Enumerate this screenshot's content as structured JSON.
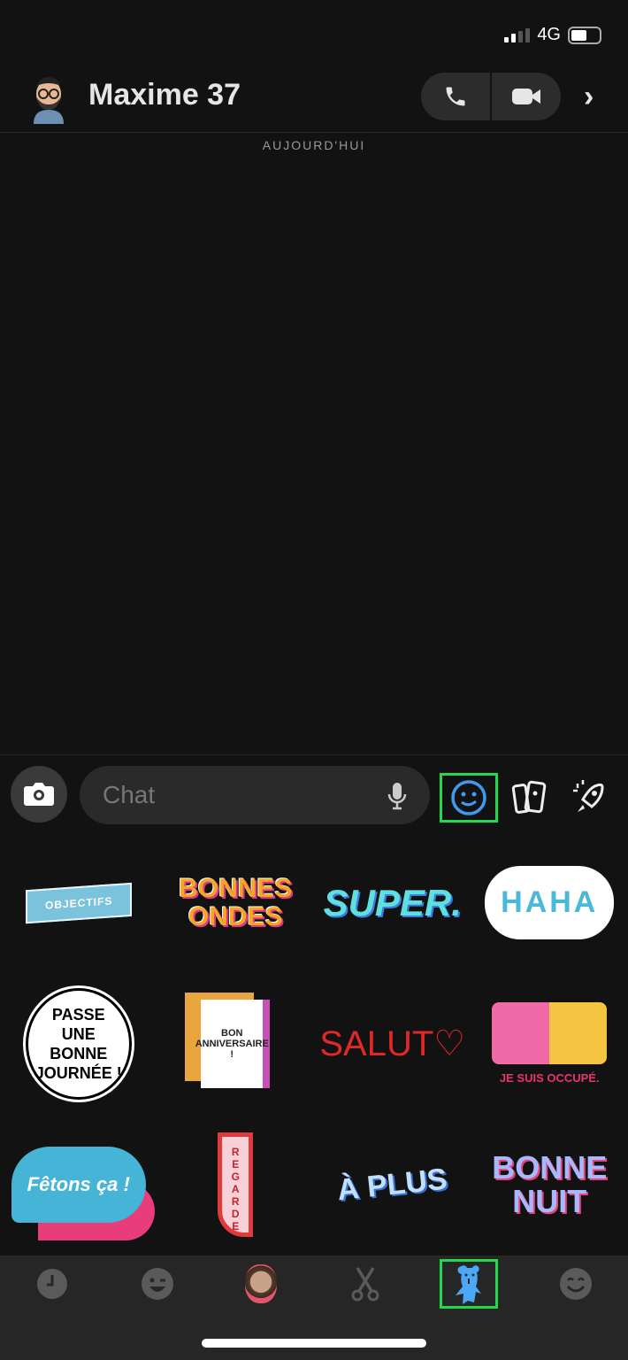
{
  "status": {
    "network": "4G",
    "signal_bars": 2,
    "battery_percent": 55
  },
  "header": {
    "contact_name": "Maxime 37"
  },
  "chat": {
    "date_separator": "AUJOURD'HUI",
    "input_placeholder": "Chat",
    "input_value": ""
  },
  "stickers": [
    {
      "text": "OBJECTIFS"
    },
    {
      "text": "BONNES ONDES"
    },
    {
      "text": "SUPER."
    },
    {
      "text": "HAHA"
    },
    {
      "text": "PASSE UNE BONNE JOURNÉE !"
    },
    {
      "text": "BON ANNIVERSAIRE !"
    },
    {
      "text": "SALUT♡"
    },
    {
      "text": "JE SUIS OCCUPÉ."
    },
    {
      "text": "Fêtons ça !"
    },
    {
      "text": "REGARDE"
    },
    {
      "text": "À PLUS"
    },
    {
      "text": "BONNE NUIT"
    }
  ],
  "colors": {
    "accent_selected": "#22d84c",
    "emoji_blue": "#3d9cf0",
    "sticker_tab_blue": "#4aa8f5"
  },
  "tabs": [
    {
      "icon": "clock-icon"
    },
    {
      "icon": "wink-emoji-icon"
    },
    {
      "icon": "cameo-face-icon"
    },
    {
      "icon": "scissors-icon"
    },
    {
      "icon": "bear-sticker-icon",
      "selected": true
    },
    {
      "icon": "smile-emoji-icon"
    }
  ]
}
